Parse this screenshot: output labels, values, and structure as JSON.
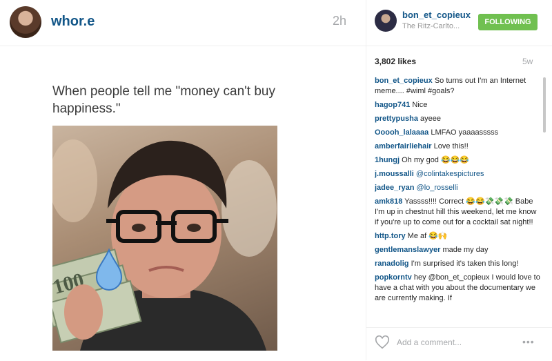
{
  "post": {
    "username": "whor.e",
    "time": "2h",
    "caption": "When people tell me \"money can't buy happiness.\""
  },
  "right": {
    "username": "bon_et_copieux",
    "location": "The Ritz-Carlto...",
    "follow_label": "FOLLOWING",
    "likes": "3,802 likes",
    "age": "5w",
    "comments": [
      {
        "user": "bon_et_copieux",
        "text": "So turns out I'm an Internet meme.... #wiml #goals?"
      },
      {
        "user": "hagop741",
        "text": "Nice"
      },
      {
        "user": "prettypusha",
        "text": "ayeee"
      },
      {
        "user": "Ooooh_lalaaaa",
        "text": "LMFAO yaaaasssss"
      },
      {
        "user": "amberfairliehair",
        "text": "Love this!!"
      },
      {
        "user": "1hungj",
        "text": "Oh my god 😂😂😂"
      },
      {
        "user": "j.moussalli",
        "text": "@colintakespictures"
      },
      {
        "user": "jadee_ryan",
        "text": "@lo_rosselli"
      },
      {
        "user": "amk818",
        "text": "Yassss!!!! Correct 😂😂💸💸💸 Babe I'm up in chestnut hill this weekend, let me know if you're up to come out for a cocktail sat night!!"
      },
      {
        "user": "http.tory",
        "text": "Me af 😂🙌"
      },
      {
        "user": "gentlemanslawyer",
        "text": "made my day"
      },
      {
        "user": "ranadolig",
        "text": "I'm surprised it's taken this long!"
      },
      {
        "user": "popkorntv",
        "text": "hey @bon_et_copieux I would love to have a chat with you about the documentary we are currently making. If"
      }
    ],
    "add_comment_placeholder": "Add a comment...",
    "more_label": "•••"
  }
}
